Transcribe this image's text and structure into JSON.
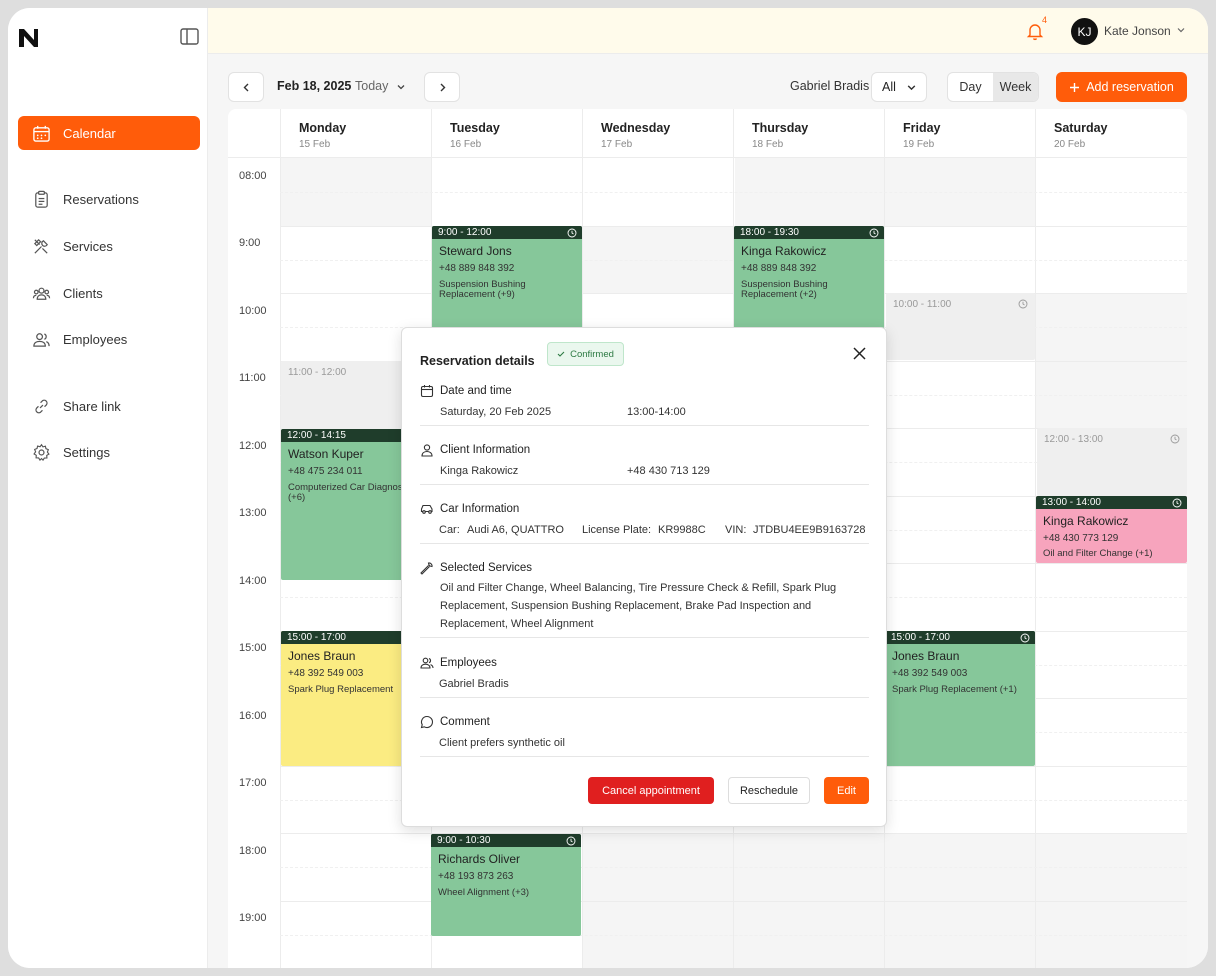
{
  "sidebar": {
    "items": [
      {
        "label": "Calendar"
      },
      {
        "label": "Reservations"
      },
      {
        "label": "Services"
      },
      {
        "label": "Clients"
      },
      {
        "label": "Employees"
      },
      {
        "label": "Share link"
      },
      {
        "label": "Settings"
      }
    ]
  },
  "topbar": {
    "notification_count": "4",
    "user_initials": "KJ",
    "user_name": "Kate Jonson"
  },
  "toolbar": {
    "date": "Feb 18, 2025",
    "today_label": "Today",
    "employee": "Gabriel Bradis",
    "employee_filter": "All",
    "view_day": "Day",
    "view_week": "Week",
    "active_view": "Week",
    "add_label": "Add reservation"
  },
  "calendar": {
    "days": [
      {
        "name": "Monday",
        "date": "15 Feb"
      },
      {
        "name": "Tuesday",
        "date": "16 Feb"
      },
      {
        "name": "Wednesday",
        "date": "17 Feb"
      },
      {
        "name": "Thursday",
        "date": "18 Feb"
      },
      {
        "name": "Friday",
        "date": "19 Feb"
      },
      {
        "name": "Saturday",
        "date": "20 Feb"
      }
    ],
    "hours": [
      "08:00",
      "9:00",
      "10:00",
      "11:00",
      "12:00",
      "13:00",
      "14:00",
      "15:00",
      "16:00",
      "17:00",
      "18:00",
      "19:00"
    ],
    "events": [
      {
        "time": "9:00 - 12:00",
        "name": "Steward Jons",
        "phone": "+48 889 848 392",
        "service": "Suspension Bushing Replacement (+9)"
      },
      {
        "time": "18:00 - 19:30",
        "name": "Kinga Rakowicz",
        "phone": "+48 889 848 392",
        "service": "Suspension Bushing Replacement (+2)"
      },
      {
        "time": "12:00 - 14:15",
        "name": "Watson Kuper",
        "phone": "+48 475 234 011",
        "service": "Computerized Car Diagnostics (+6)"
      },
      {
        "time": "15:00 - 17:00",
        "name": "Jones Braun",
        "phone": "+48  392 549 003",
        "service": "Spark Plug Replacement"
      },
      {
        "time": "15:00 - 17:00",
        "name": "Jones Braun",
        "phone": "+48  392 549 003",
        "service": "Spark Plug Replacement (+1)"
      },
      {
        "time": "13:00 - 14:00",
        "name": "Kinga Rakowicz",
        "phone": "+48 430 773 129",
        "service": "Oil and Filter Change (+1)"
      },
      {
        "time": "9:00 - 10:30",
        "name": "Richards Oliver",
        "phone": "+48 193 873 263",
        "service": "Wheel Alignment (+3)"
      }
    ],
    "ghosts": [
      "11:00 - 12:00",
      "10:00 - 11:00",
      "12:00 - 13:00"
    ]
  },
  "modal": {
    "title": "Reservation details",
    "status": "Confirmed",
    "date_heading": "Date and time",
    "date_value": "Saturday, 20 Feb 2025",
    "time_value": "13:00-14:00",
    "client_heading": "Client Information",
    "client_name": "Kinga Rakowicz",
    "client_phone": "+48 430 713 129",
    "car_heading": "Car Information",
    "car_label": "Car:",
    "car_value": "Audi A6, QUATTRO",
    "plate_label": "License Plate:",
    "plate_value": "KR9988C",
    "vin_label": "VIN:",
    "vin_value": "JTDBU4EE9B9163728",
    "services_heading": "Selected Services",
    "services_value": "Oil and Filter Change, Wheel Balancing, Tire Pressure Check & Refill, Spark Plug Replacement, Suspension Bushing Replacement, Brake Pad Inspection and Replacement, Wheel Alignment",
    "employees_heading": "Employees",
    "employees_value": "Gabriel Bradis",
    "comment_heading": "Comment",
    "comment_value": "Client prefers synthetic oil",
    "cancel_label": "Cancel appointment",
    "reschedule_label": "Reschedule",
    "edit_label": "Edit"
  },
  "colors": {
    "accent": "#ff5c0a",
    "event_green": "#86c79a",
    "event_yellow": "#fbec82",
    "event_pink": "#f7a4bd",
    "event_header": "#1f3d2b",
    "danger": "#e01f1f"
  }
}
